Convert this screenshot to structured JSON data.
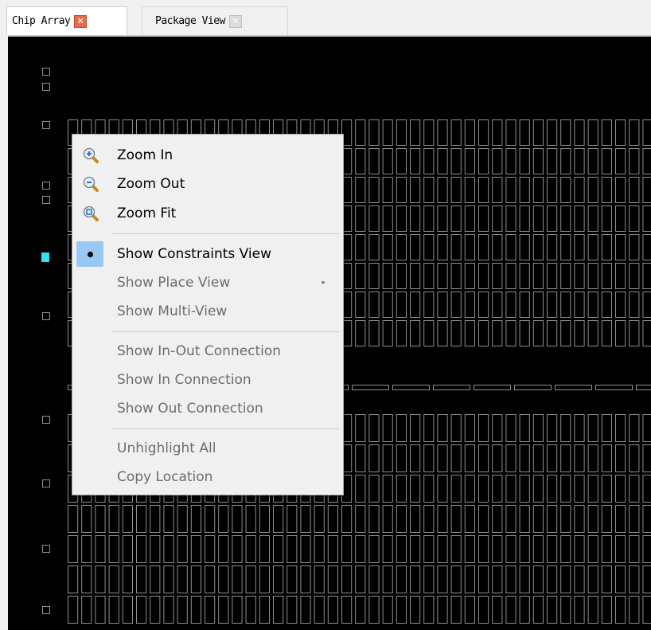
{
  "tabs": [
    {
      "label": "Chip Array",
      "active": true,
      "close_icon": "close-icon",
      "close_color": "#e86b4a"
    },
    {
      "label": "Package View",
      "active": false,
      "close_icon": "close-icon",
      "close_color": "#dcdcdc"
    }
  ],
  "canvas": {
    "background": "#000000",
    "cell_outline_color": "#8f8f8f",
    "highlight_color": "#2fe3ef"
  },
  "menu": {
    "items": [
      {
        "label": "Zoom In",
        "icon": "zoom-in-icon",
        "enabled": true
      },
      {
        "label": "Zoom Out",
        "icon": "zoom-out-icon",
        "enabled": true
      },
      {
        "label": "Zoom Fit",
        "icon": "zoom-fit-icon",
        "enabled": true
      },
      {
        "label": "Show Constraints View",
        "checked": true,
        "enabled": true
      },
      {
        "label": "Show Place View",
        "enabled": false,
        "has_submenu": true
      },
      {
        "label": "Show Multi-View",
        "enabled": false
      },
      {
        "label": "Show In-Out Connection",
        "enabled": false
      },
      {
        "label": "Show In Connection",
        "enabled": false
      },
      {
        "label": "Show Out Connection",
        "enabled": false
      },
      {
        "label": "Unhighlight All",
        "enabled": false
      },
      {
        "label": "Copy Location",
        "enabled": false
      }
    ],
    "submenu_arrow": "▸"
  }
}
